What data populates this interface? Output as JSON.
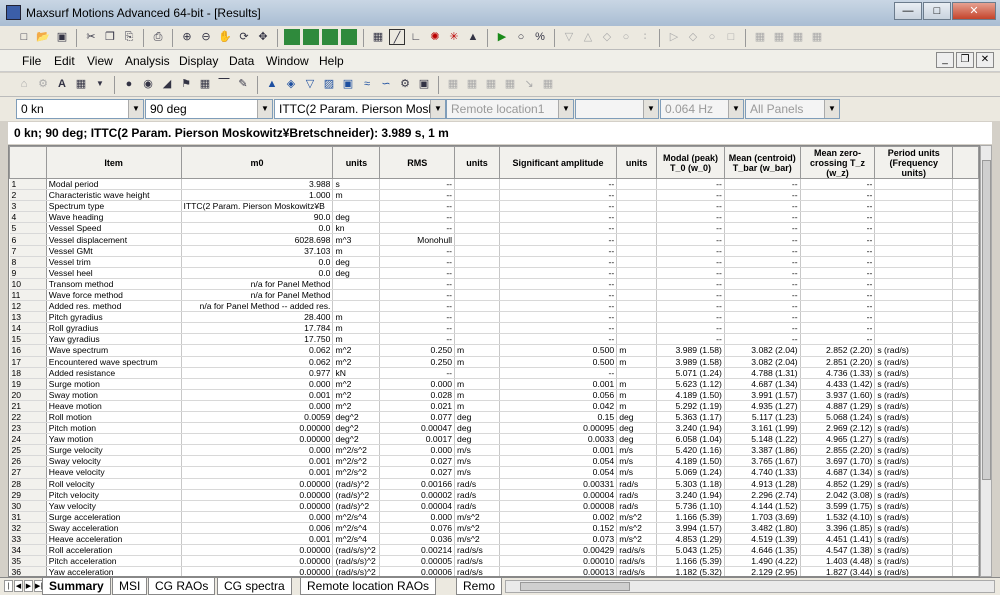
{
  "window": {
    "title": "Maxsurf Motions Advanced 64-bit - [Results]"
  },
  "menu": [
    "File",
    "Edit",
    "View",
    "Analysis",
    "Display",
    "Data",
    "Window",
    "Help"
  ],
  "selectors": {
    "speed": "0 kn",
    "heading": "90 deg",
    "spectrum": "ITTC(2 Param. Pierson Moskow",
    "location": "Remote location1",
    "blank": "",
    "frequency": "0.064 Hz",
    "panels": "All Panels"
  },
  "info": "0 kn; 90 deg; ITTC(2 Param. Pierson Moskowitz¥Bretschneider): 3.989 s, 1 m",
  "table": {
    "headers": [
      "",
      "Item",
      "m0",
      "units",
      "RMS",
      "units",
      "Significant amplitude",
      "units",
      "Modal (peak) T_0   (w_0)",
      "Mean (centroid) T_bar (w_bar)",
      "Mean zero-crossing T_z   (w_z)",
      "Period units (Frequency units)"
    ],
    "rows": [
      [
        "1",
        "Modal period",
        "3.988",
        "s",
        "--",
        "",
        "--",
        "",
        "--",
        "--",
        "--",
        ""
      ],
      [
        "2",
        "Characteristic wave height",
        "1.000",
        "m",
        "--",
        "",
        "--",
        "",
        "--",
        "--",
        "--",
        ""
      ],
      [
        "3",
        "Spectrum type",
        "ITTC(2 Param. Pierson Moskowitz¥B",
        "",
        "--",
        "",
        "--",
        "",
        "--",
        "--",
        "--",
        ""
      ],
      [
        "4",
        "Wave heading",
        "90.0",
        "deg",
        "--",
        "",
        "--",
        "",
        "--",
        "--",
        "--",
        ""
      ],
      [
        "5",
        "Vessel Speed",
        "0.0",
        "kn",
        "--",
        "",
        "--",
        "",
        "--",
        "--",
        "--",
        ""
      ],
      [
        "6",
        "Vessel displacement",
        "6028.698",
        "m^3",
        "Monohull",
        "",
        "--",
        "",
        "--",
        "--",
        "--",
        ""
      ],
      [
        "7",
        "Vessel GMt",
        "37.103",
        "m",
        "--",
        "",
        "--",
        "",
        "--",
        "--",
        "--",
        ""
      ],
      [
        "8",
        "Vessel trim",
        "0.0",
        "deg",
        "--",
        "",
        "--",
        "",
        "--",
        "--",
        "--",
        ""
      ],
      [
        "9",
        "Vessel heel",
        "0.0",
        "deg",
        "--",
        "",
        "--",
        "",
        "--",
        "--",
        "--",
        ""
      ],
      [
        "10",
        "Transom method",
        "n/a for Panel Method",
        "",
        "--",
        "",
        "--",
        "",
        "--",
        "--",
        "--",
        ""
      ],
      [
        "11",
        "Wave force method",
        "n/a for Panel Method",
        "",
        "--",
        "",
        "--",
        "",
        "--",
        "--",
        "--",
        ""
      ],
      [
        "12",
        "Added res. method",
        "n/a for Panel Method -- added res.",
        "",
        "--",
        "",
        "--",
        "",
        "--",
        "--",
        "--",
        ""
      ],
      [
        "13",
        "Pitch gyradius",
        "28.400",
        "m",
        "--",
        "",
        "--",
        "",
        "--",
        "--",
        "--",
        ""
      ],
      [
        "14",
        "Roll gyradius",
        "17.784",
        "m",
        "--",
        "",
        "--",
        "",
        "--",
        "--",
        "--",
        ""
      ],
      [
        "15",
        "Yaw gyradius",
        "17.750",
        "m",
        "--",
        "",
        "--",
        "",
        "--",
        "--",
        "--",
        ""
      ],
      [
        "16",
        "Wave spectrum",
        "0.062",
        "m^2",
        "0.250",
        "m",
        "0.500",
        "m",
        "3.989 (1.58)",
        "3.082 (2.04)",
        "2.852 (2.20)",
        "s (rad/s)"
      ],
      [
        "17",
        "Encountered wave spectrum",
        "0.062",
        "m^2",
        "0.250",
        "m",
        "0.500",
        "m",
        "3.989 (1.58)",
        "3.082 (2.04)",
        "2.851 (2.20)",
        "s (rad/s)"
      ],
      [
        "18",
        "Added resistance",
        "0.977",
        "kN",
        "--",
        "",
        "--",
        "",
        "5.071 (1.24)",
        "4.788 (1.31)",
        "4.736 (1.33)",
        "s (rad/s)"
      ],
      [
        "19",
        "Surge motion",
        "0.000",
        "m^2",
        "0.000",
        "m",
        "0.001",
        "m",
        "5.623 (1.12)",
        "4.687 (1.34)",
        "4.433 (1.42)",
        "s (rad/s)"
      ],
      [
        "20",
        "Sway motion",
        "0.001",
        "m^2",
        "0.028",
        "m",
        "0.056",
        "m",
        "4.189 (1.50)",
        "3.991 (1.57)",
        "3.937 (1.60)",
        "s (rad/s)"
      ],
      [
        "21",
        "Heave motion",
        "0.000",
        "m^2",
        "0.021",
        "m",
        "0.042",
        "m",
        "5.292 (1.19)",
        "4.935 (1.27)",
        "4.887 (1.29)",
        "s (rad/s)"
      ],
      [
        "22",
        "Roll motion",
        "0.0059",
        "deg^2",
        "0.077",
        "deg",
        "0.15",
        "deg",
        "5.363 (1.17)",
        "5.117 (1.23)",
        "5.068 (1.24)",
        "s (rad/s)"
      ],
      [
        "23",
        "Pitch motion",
        "0.00000",
        "deg^2",
        "0.00047",
        "deg",
        "0.00095",
        "deg",
        "3.240 (1.94)",
        "3.161 (1.99)",
        "2.969 (2.12)",
        "s (rad/s)"
      ],
      [
        "24",
        "Yaw motion",
        "0.00000",
        "deg^2",
        "0.0017",
        "deg",
        "0.0033",
        "deg",
        "6.058 (1.04)",
        "5.148 (1.22)",
        "4.965 (1.27)",
        "s (rad/s)"
      ],
      [
        "25",
        "Surge velocity",
        "0.000",
        "m^2/s^2",
        "0.000",
        "m/s",
        "0.001",
        "m/s",
        "5.420 (1.16)",
        "3.387 (1.86)",
        "2.855 (2.20)",
        "s (rad/s)"
      ],
      [
        "26",
        "Sway velocity",
        "0.001",
        "m^2/s^2",
        "0.027",
        "m/s",
        "0.054",
        "m/s",
        "4.189 (1.50)",
        "3.765 (1.67)",
        "3.697 (1.70)",
        "s (rad/s)"
      ],
      [
        "27",
        "Heave velocity",
        "0.001",
        "m^2/s^2",
        "0.027",
        "m/s",
        "0.054",
        "m/s",
        "5.069 (1.24)",
        "4.740 (1.33)",
        "4.687 (1.34)",
        "s (rad/s)"
      ],
      [
        "28",
        "Roll velocity",
        "0.00000",
        "(rad/s)^2",
        "0.00166",
        "rad/s",
        "0.00331",
        "rad/s",
        "5.303 (1.18)",
        "4.913 (1.28)",
        "4.852 (1.29)",
        "s (rad/s)"
      ],
      [
        "29",
        "Pitch velocity",
        "0.00000",
        "(rad/s)^2",
        "0.00002",
        "rad/s",
        "0.00004",
        "rad/s",
        "3.240 (1.94)",
        "2.296 (2.74)",
        "2.042 (3.08)",
        "s (rad/s)"
      ],
      [
        "30",
        "Yaw velocity",
        "0.00000",
        "(rad/s)^2",
        "0.00004",
        "rad/s",
        "0.00008",
        "rad/s",
        "5.736 (1.10)",
        "4.144 (1.52)",
        "3.599 (1.75)",
        "s (rad/s)"
      ],
      [
        "31",
        "Surge acceleration",
        "0.000",
        "m^2/s^4",
        "0.000",
        "m/s^2",
        "0.002",
        "m/s^2",
        "1.166 (5.39)",
        "1.703 (3.69)",
        "1.532 (4.10)",
        "s (rad/s)"
      ],
      [
        "32",
        "Sway acceleration",
        "0.006",
        "m^2/s^4",
        "0.076",
        "m/s^2",
        "0.152",
        "m/s^2",
        "3.994 (1.57)",
        "3.482 (1.80)",
        "3.396 (1.85)",
        "s (rad/s)"
      ],
      [
        "33",
        "Heave acceleration",
        "0.001",
        "m^2/s^4",
        "0.036",
        "m/s^2",
        "0.073",
        "m/s^2",
        "4.853 (1.29)",
        "4.519 (1.39)",
        "4.451 (1.41)",
        "s (rad/s)"
      ],
      [
        "34",
        "Roll acceleration",
        "0.00000",
        "(rad/s/s)^2",
        "0.00214",
        "rad/s/s",
        "0.00429",
        "rad/s/s",
        "5.043 (1.25)",
        "4.646 (1.35)",
        "4.547 (1.38)",
        "s (rad/s)"
      ],
      [
        "35",
        "Pitch acceleration",
        "0.00000",
        "(rad/s/s)^2",
        "0.00005",
        "rad/s/s",
        "0.00010",
        "rad/s/s",
        "1.166 (5.39)",
        "1.490 (4.22)",
        "1.403 (4.48)",
        "s (rad/s)"
      ],
      [
        "36",
        "Yaw acceleration",
        "0.00000",
        "(rad/s/s)^2",
        "0.00006",
        "rad/s/s",
        "0.00013",
        "rad/s/s",
        "1.182 (5.32)",
        "2.129 (2.95)",
        "1.827 (3.44)",
        "s (rad/s)"
      ]
    ]
  },
  "tabs": [
    "Summary",
    "MSI",
    "CG RAOs",
    "CG spectra",
    "Remote location RAOs",
    "Remo"
  ]
}
